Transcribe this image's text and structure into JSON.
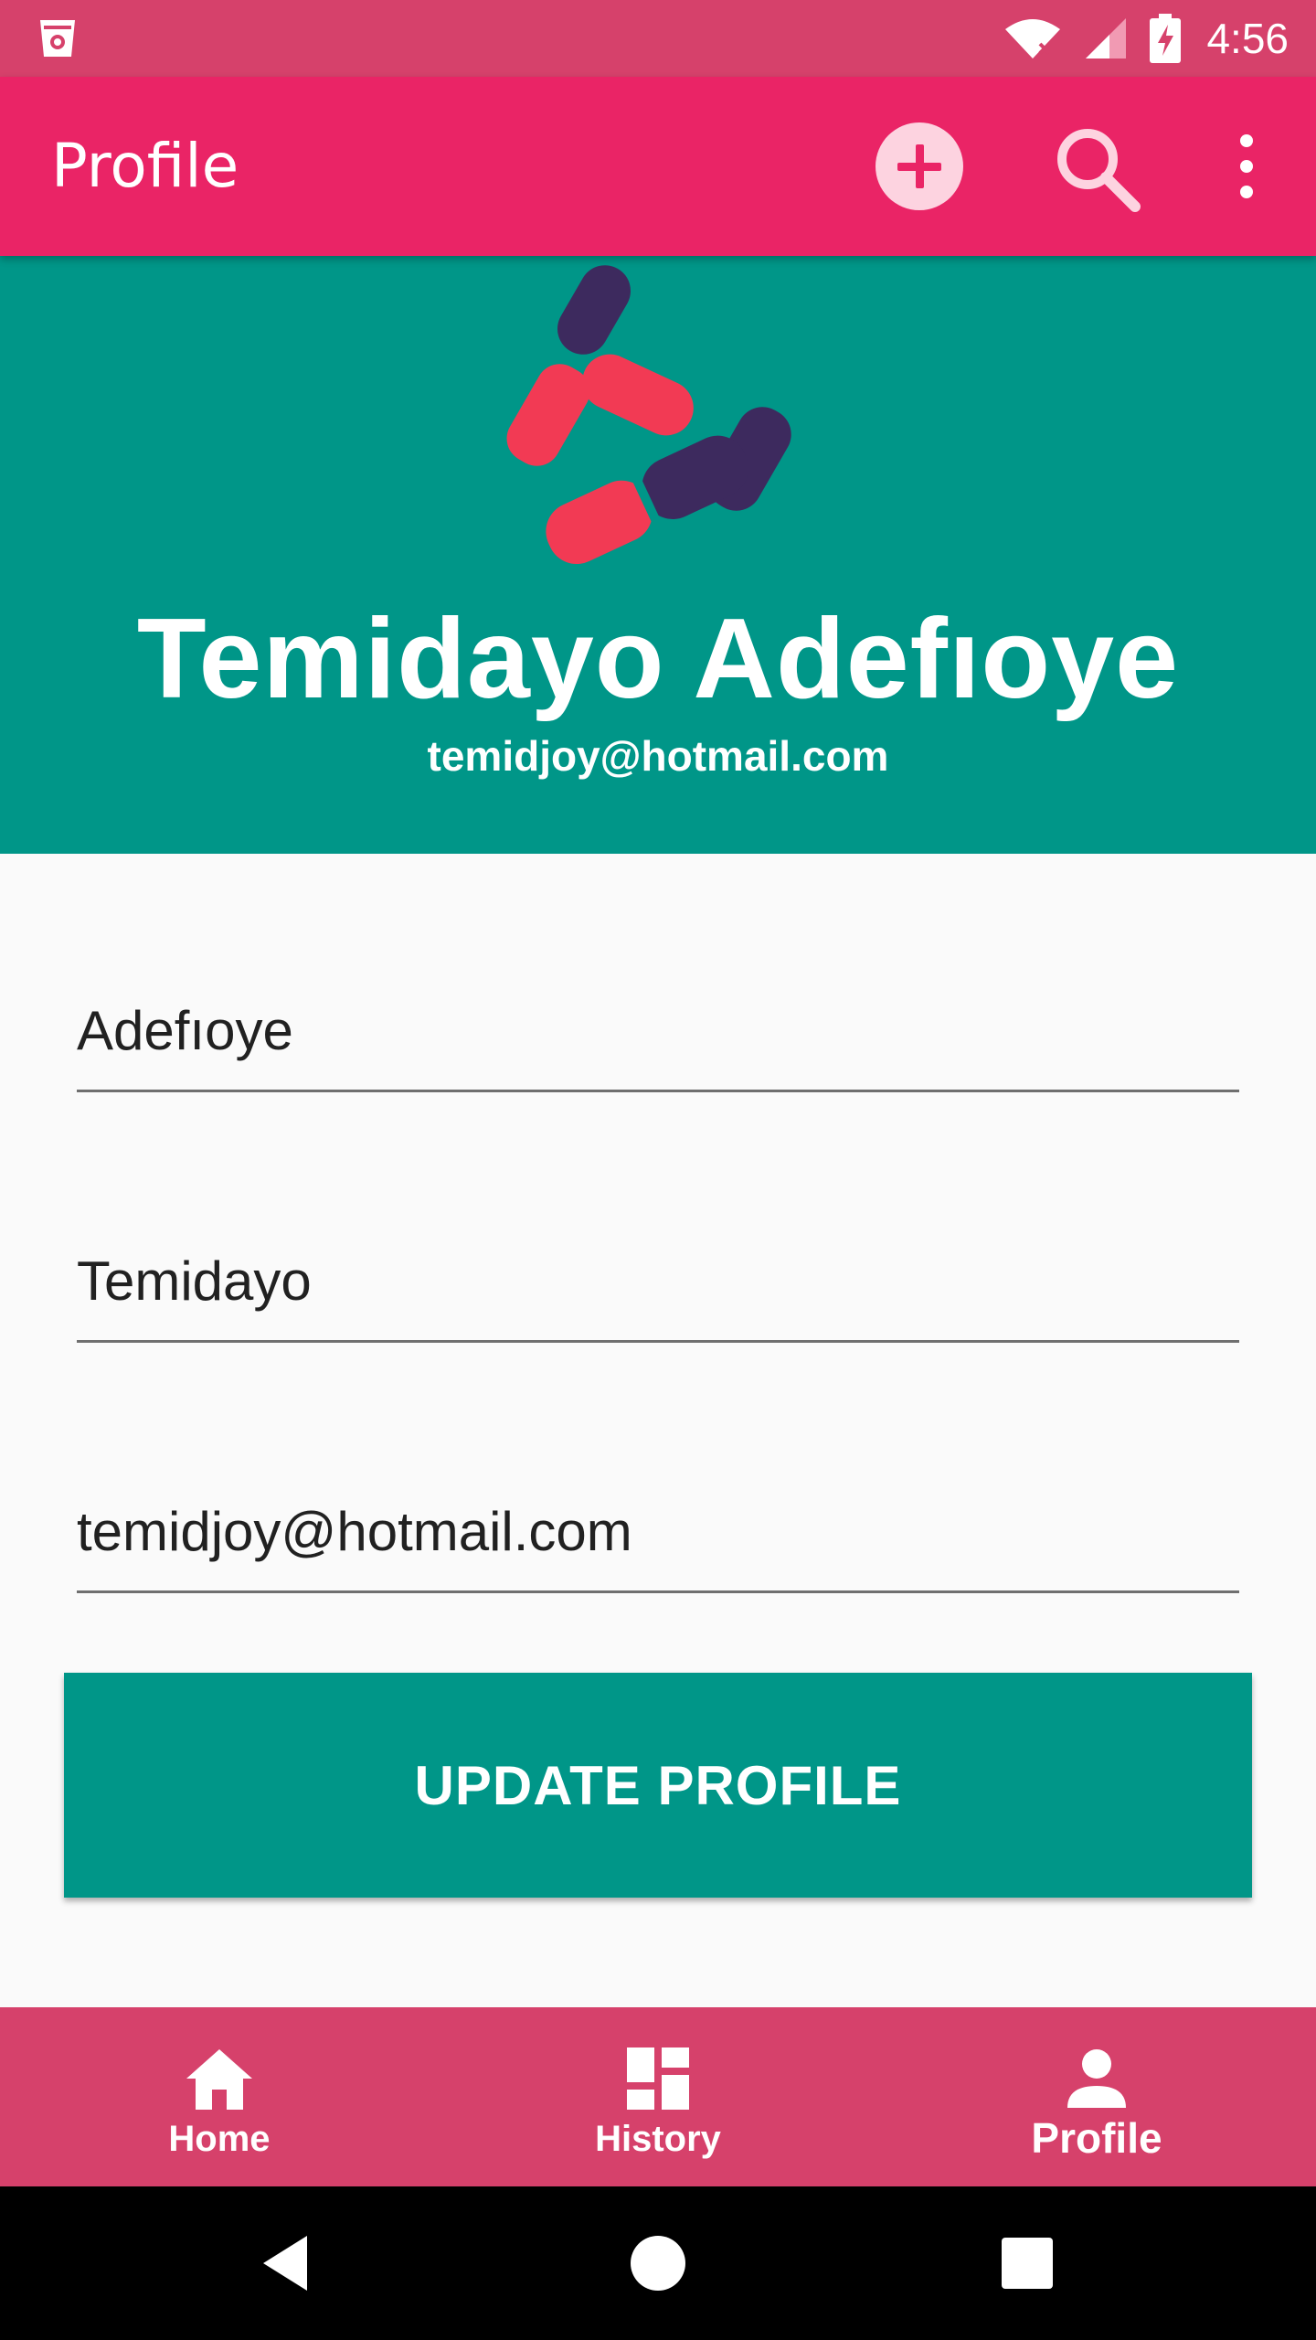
{
  "status_bar": {
    "time": "4:56",
    "icons": [
      "app-notification-icon",
      "wifi-icon",
      "signal-icon",
      "battery-charging-icon"
    ]
  },
  "app_bar": {
    "title": "Profile",
    "actions": [
      "add-icon",
      "search-icon",
      "more-vert-icon"
    ]
  },
  "header": {
    "name": "Temidayo Adefıoye",
    "email": "temidjoy@hotmail.com"
  },
  "form": {
    "last_name": "Adefıoye",
    "first_name": "Temidayo",
    "email": "temidjoy@hotmail.com",
    "update_label": "UPDATE PROFILE"
  },
  "bottom_nav": {
    "items": [
      {
        "label": "Home",
        "icon": "home-icon"
      },
      {
        "label": "History",
        "icon": "dashboard-icon"
      },
      {
        "label": "Profile",
        "icon": "person-icon",
        "active": true
      }
    ]
  },
  "colors": {
    "status_bar": "#d6416b",
    "app_bar": "#ea2466",
    "primary": "#009688",
    "bottom_nav": "#d6416b",
    "logo_red": "#f23a54",
    "logo_purple": "#3d2a5e"
  }
}
